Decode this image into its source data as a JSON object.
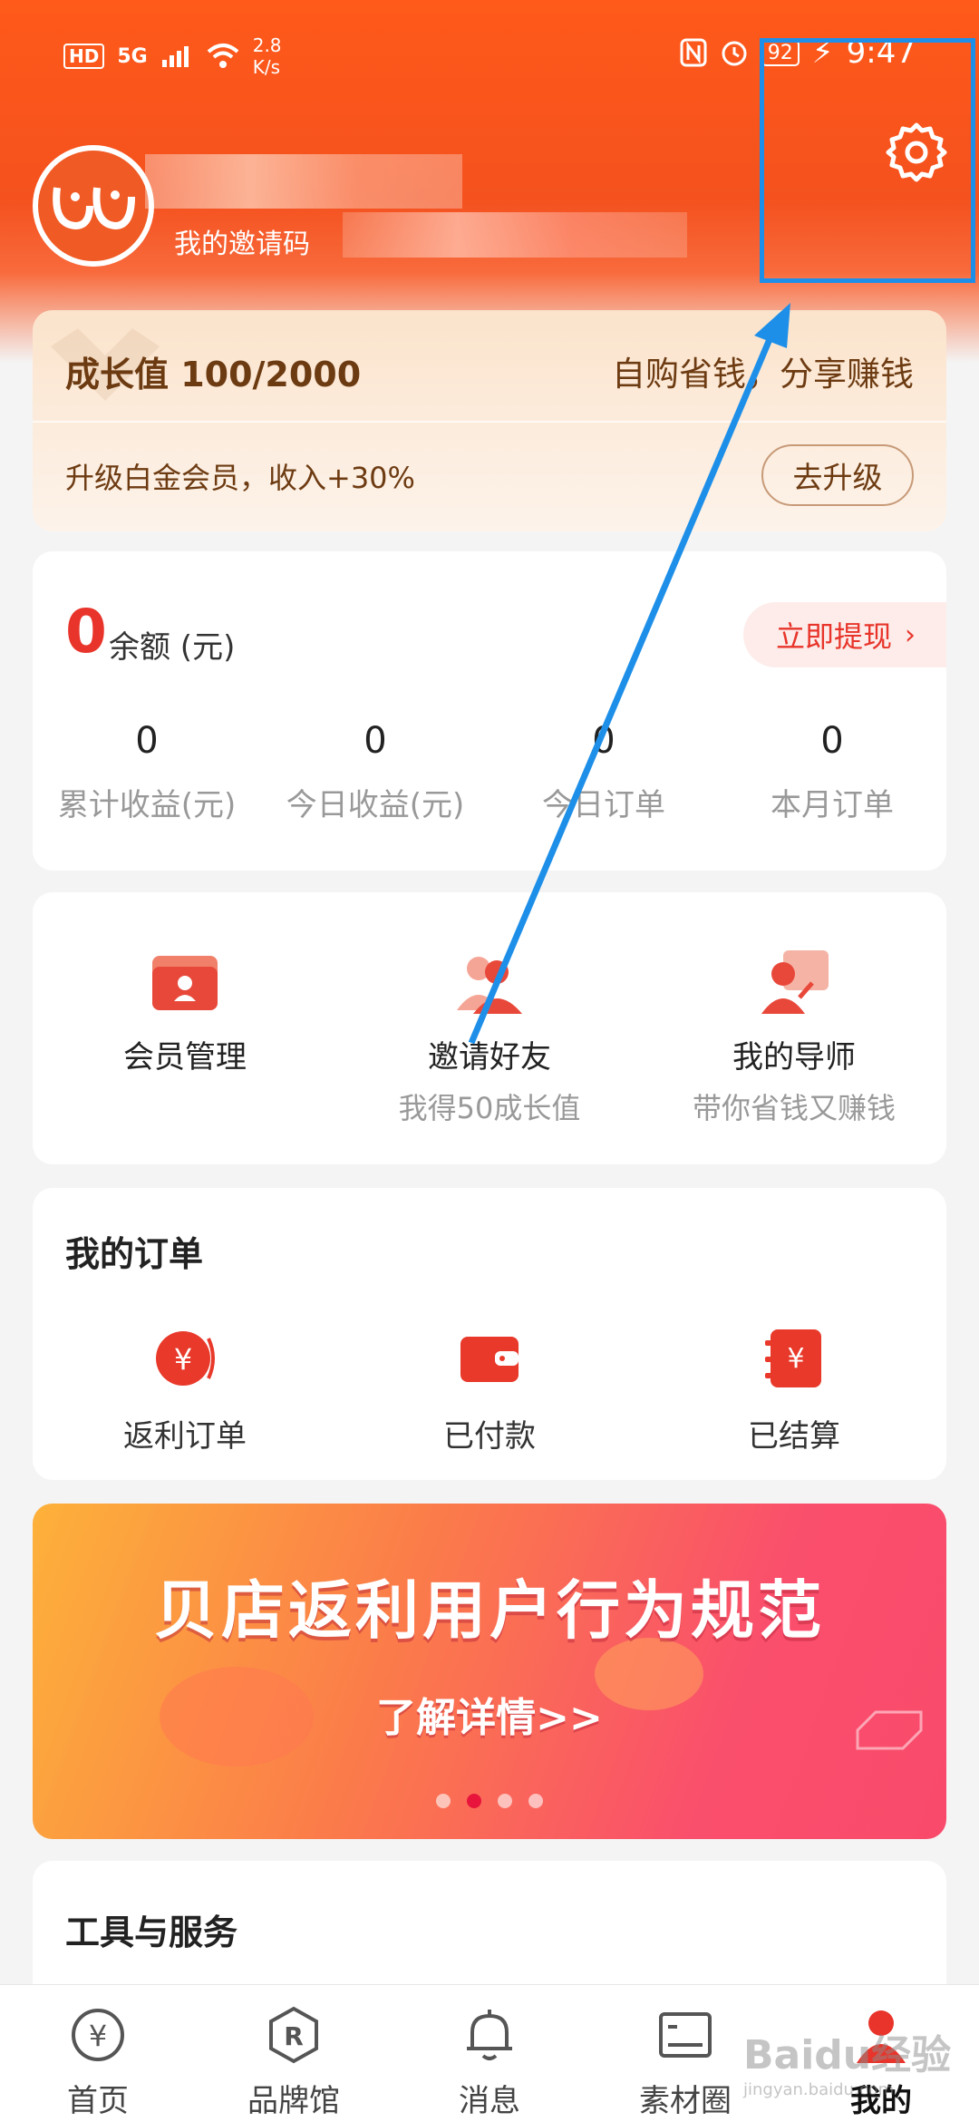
{
  "status_bar": {
    "hd": "HD",
    "signal": "5G",
    "net_rate": "2.8\nK/s",
    "battery": "92",
    "time": "9:47"
  },
  "profile": {
    "invite_code_label": "我的邀请码"
  },
  "growth": {
    "value": "成长值 100/2000",
    "slogan": "自购省钱，分享赚钱",
    "tip": "升级白金会员，收入+30%",
    "upgrade_button": "去升级"
  },
  "balance": {
    "value": "0",
    "label": "余额 (元)",
    "withdraw_button": "立即提现",
    "stats": [
      {
        "value": "0",
        "label": "累计收益(元)"
      },
      {
        "value": "0",
        "label": "今日收益(元)"
      },
      {
        "value": "0",
        "label": "今日订单"
      },
      {
        "value": "0",
        "label": "本月订单"
      }
    ]
  },
  "features": [
    {
      "title": "会员管理",
      "subtitle": "",
      "icon": "member-card-icon"
    },
    {
      "title": "邀请好友",
      "subtitle": "我得50成长值",
      "icon": "invite-friends-icon"
    },
    {
      "title": "我的导师",
      "subtitle": "带你省钱又赚钱",
      "icon": "mentor-icon"
    }
  ],
  "orders": {
    "title": "我的订单",
    "items": [
      {
        "label": "返利订单",
        "icon": "rebate-order-icon"
      },
      {
        "label": "已付款",
        "icon": "wallet-icon"
      },
      {
        "label": "已结算",
        "icon": "settled-icon"
      }
    ]
  },
  "banner": {
    "title": "贝店返利用户行为规范",
    "subtitle": "了解详情>>",
    "page_count": 4,
    "active_index": 1
  },
  "tools": {
    "title": "工具与服务"
  },
  "tabbar": [
    {
      "label": "首页",
      "icon": "yuan-home-icon"
    },
    {
      "label": "品牌馆",
      "icon": "brand-r-icon"
    },
    {
      "label": "消息",
      "icon": "bell-icon"
    },
    {
      "label": "素材圈",
      "icon": "picture-icon"
    },
    {
      "label": "我的",
      "icon": "user-icon"
    }
  ],
  "watermark": {
    "text": "Baidu经验",
    "sub": "jingyan.baidu.com"
  },
  "colors": {
    "accent": "#f4511e",
    "red": "#e8342a",
    "highlight": "#1e8fe8"
  }
}
